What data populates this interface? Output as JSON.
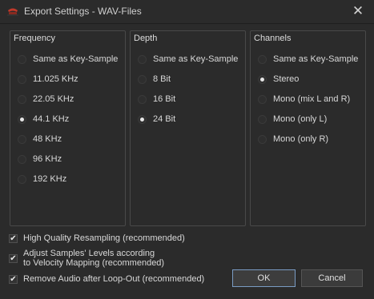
{
  "window": {
    "title": "Export Settings - WAV-Files"
  },
  "groups": {
    "frequency": {
      "title": "Frequency",
      "options": [
        "Same as Key-Sample",
        "11.025 KHz",
        "22.05 KHz",
        "44.1 KHz",
        "48 KHz",
        "96 KHz",
        "192 KHz"
      ],
      "selected": "44.1 KHz"
    },
    "depth": {
      "title": "Depth",
      "options": [
        "Same as Key-Sample",
        "8 Bit",
        "16 Bit",
        "24 Bit"
      ],
      "selected": "24 Bit"
    },
    "channels": {
      "title": "Channels",
      "options": [
        "Same as Key-Sample",
        "Stereo",
        "Mono (mix L and R)",
        "Mono (only L)",
        "Mono (only R)"
      ],
      "selected": "Stereo"
    }
  },
  "options": {
    "high_quality": {
      "label": "High Quality Resampling (recommended)",
      "checked": true
    },
    "adjust_levels": {
      "label_line1": "Adjust Samples' Levels according",
      "label_line2": "to Velocity Mapping (recommended)",
      "checked": true
    },
    "remove_audio": {
      "label": "Remove Audio after Loop-Out (recommended)",
      "checked": true
    }
  },
  "buttons": {
    "ok": "OK",
    "cancel": "Cancel"
  },
  "colors": {
    "background": "#2b2b2b",
    "ok_border": "#7a9cc4"
  }
}
